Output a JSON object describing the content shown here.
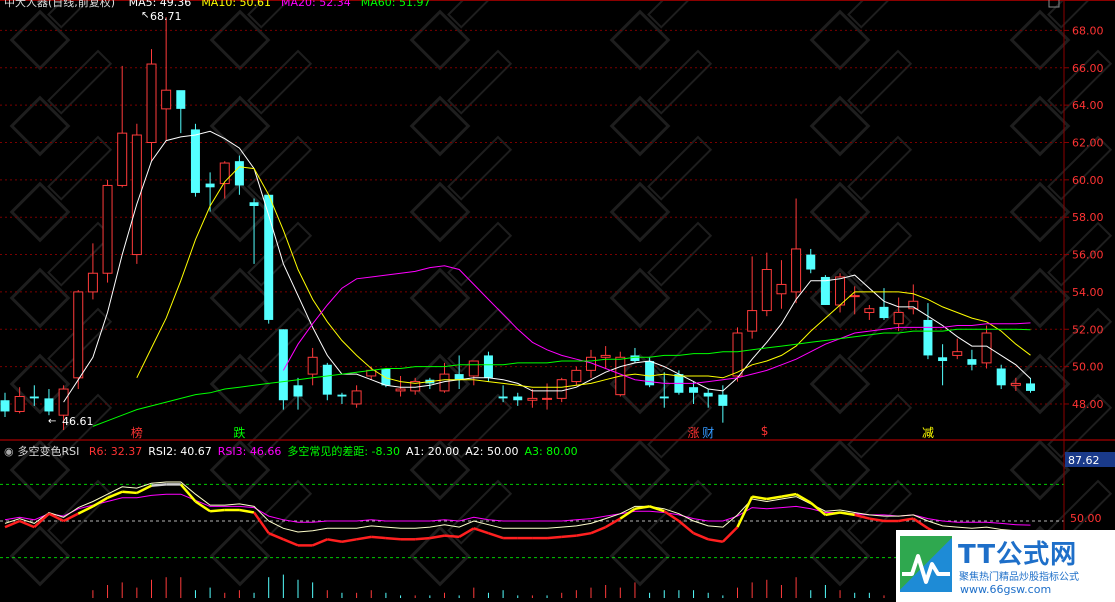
{
  "header": {
    "title": "中大人器(日线,前复权)",
    "ma": [
      {
        "label": "MA5: 49.36",
        "color": "#ffffff"
      },
      {
        "label": "MA10: 50.61",
        "color": "#ffff00"
      },
      {
        "label": "MA20: 52.34",
        "color": "#ff00ff"
      },
      {
        "label": "MA60: 51.97",
        "color": "#00ff00"
      }
    ]
  },
  "sub_header": {
    "title": "多空变色RSI",
    "items": [
      {
        "label": "R6: 32.37",
        "color": "#ff3333"
      },
      {
        "label": "RSI2: 40.67",
        "color": "#ffffff"
      },
      {
        "label": "RSI3: 46.66",
        "color": "#ff00ff"
      },
      {
        "label": "多空常见的差距: -8.30",
        "color": "#00ff00"
      },
      {
        "label": "A1: 20.00",
        "color": "#ffffff"
      },
      {
        "label": "A2: 50.00",
        "color": "#ffffff"
      },
      {
        "label": "A3: 80.00",
        "color": "#00ff00"
      }
    ]
  },
  "markers": [
    {
      "text": "榜",
      "color": "#ff3333",
      "i": 9
    },
    {
      "text": "跌",
      "color": "#00ff00",
      "i": 16
    },
    {
      "text": "涨",
      "color": "#ff3333",
      "i": 47
    },
    {
      "text": "财",
      "color": "#3399ff",
      "i": 48
    },
    {
      "text": "$",
      "color": "#ff3333",
      "i": 52
    },
    {
      "text": "减",
      "color": "#ffff00",
      "i": 63
    }
  ],
  "annotations": {
    "high": "68.71",
    "low": "46.61"
  },
  "sub_axis_labels": {
    "top": "87.62",
    "mid": "50.00"
  },
  "logo": {
    "brand": "TT公式网",
    "slogan": "聚焦热门精品炒股指标公式",
    "url": "www.66gsw.com"
  },
  "chart_data": {
    "type": "candlestick",
    "ylim": [
      46.5,
      69.2
    ],
    "yticks": [
      48,
      50,
      52,
      54,
      56,
      58,
      60,
      62,
      64,
      66,
      68
    ],
    "ytick_labels": [
      "48.00",
      "50.00",
      "52.00",
      "54.00",
      "56.00",
      "58.00",
      "60.00",
      "62.00",
      "64.00",
      "66.00",
      "68.00"
    ],
    "ohlc": [
      [
        48.2,
        48.6,
        47.3,
        47.6
      ],
      [
        47.6,
        48.9,
        47.5,
        48.4
      ],
      [
        48.4,
        49.0,
        47.9,
        48.3
      ],
      [
        48.3,
        48.8,
        47.4,
        47.6
      ],
      [
        47.4,
        49.0,
        46.61,
        48.8
      ],
      [
        49.4,
        54.1,
        48.8,
        54.0
      ],
      [
        54.0,
        56.6,
        53.6,
        55.0
      ],
      [
        55.0,
        60.0,
        54.5,
        59.7
      ],
      [
        59.7,
        66.1,
        59.6,
        62.5
      ],
      [
        56.0,
        63.0,
        55.5,
        62.4
      ],
      [
        62.0,
        67.0,
        61.0,
        66.2
      ],
      [
        63.8,
        68.71,
        62.1,
        64.8
      ],
      [
        64.8,
        64.6,
        62.5,
        63.8
      ],
      [
        62.7,
        63.0,
        59.1,
        59.3
      ],
      [
        59.8,
        60.4,
        58.3,
        59.6
      ],
      [
        59.8,
        61.0,
        59.0,
        60.9
      ],
      [
        61.0,
        61.3,
        59.2,
        59.7
      ],
      [
        58.8,
        59.0,
        55.5,
        58.6
      ],
      [
        59.2,
        59.2,
        52.3,
        52.5
      ],
      [
        52.0,
        52.0,
        47.7,
        48.2
      ],
      [
        49.0,
        49.4,
        47.7,
        48.4
      ],
      [
        49.6,
        51.0,
        49.0,
        50.5
      ],
      [
        50.1,
        50.2,
        48.2,
        48.5
      ],
      [
        48.5,
        48.6,
        48.0,
        48.4
      ],
      [
        48.0,
        49.0,
        47.8,
        48.7
      ],
      [
        49.5,
        50.0,
        49.3,
        49.8
      ],
      [
        49.9,
        49.9,
        48.9,
        49.0
      ],
      [
        48.7,
        49.5,
        48.4,
        48.8
      ],
      [
        48.7,
        49.4,
        48.5,
        49.2
      ],
      [
        49.3,
        49.4,
        48.8,
        49.1
      ],
      [
        48.7,
        50.2,
        48.6,
        49.6
      ],
      [
        49.6,
        50.6,
        48.8,
        49.3
      ],
      [
        49.5,
        50.3,
        49.0,
        50.3
      ],
      [
        50.6,
        50.8,
        49.2,
        49.4
      ],
      [
        48.4,
        49.0,
        48.1,
        48.3
      ],
      [
        48.4,
        48.6,
        47.9,
        48.2
      ],
      [
        48.2,
        48.8,
        47.8,
        48.3
      ],
      [
        48.3,
        49.1,
        47.7,
        48.3
      ],
      [
        48.3,
        49.4,
        48.1,
        49.3
      ],
      [
        49.2,
        50.0,
        49.0,
        49.8
      ],
      [
        49.8,
        50.9,
        49.4,
        50.5
      ],
      [
        50.5,
        51.1,
        49.9,
        50.6
      ],
      [
        48.5,
        50.8,
        48.4,
        50.5
      ],
      [
        50.6,
        51.0,
        50.2,
        50.3
      ],
      [
        50.3,
        50.5,
        48.9,
        49.0
      ],
      [
        48.4,
        49.7,
        47.8,
        48.3
      ],
      [
        49.6,
        49.8,
        48.5,
        48.6
      ],
      [
        48.9,
        49.2,
        48.0,
        48.6
      ],
      [
        48.6,
        48.8,
        47.8,
        48.4
      ],
      [
        48.5,
        49.0,
        47.0,
        47.9
      ],
      [
        49.5,
        52.1,
        49.2,
        51.8
      ],
      [
        51.9,
        55.9,
        51.5,
        53.0
      ],
      [
        53.0,
        56.1,
        52.7,
        55.2
      ],
      [
        53.9,
        55.7,
        53.1,
        54.4
      ],
      [
        54.0,
        59.0,
        53.4,
        56.3
      ],
      [
        56.0,
        56.3,
        55.0,
        55.2
      ],
      [
        54.8,
        54.9,
        53.3,
        53.3
      ],
      [
        53.3,
        55.0,
        52.9,
        54.8
      ],
      [
        53.8,
        54.3,
        52.8,
        53.8
      ],
      [
        52.9,
        53.3,
        52.5,
        53.1
      ],
      [
        53.2,
        54.2,
        52.5,
        52.6
      ],
      [
        52.3,
        53.7,
        51.9,
        52.9
      ],
      [
        53.1,
        54.4,
        52.8,
        53.5
      ],
      [
        52.5,
        53.4,
        50.4,
        50.6
      ],
      [
        50.5,
        51.2,
        49.0,
        50.3
      ],
      [
        50.6,
        51.5,
        50.4,
        50.8
      ],
      [
        50.4,
        50.9,
        49.8,
        50.1
      ],
      [
        50.2,
        52.2,
        49.9,
        51.8
      ],
      [
        49.9,
        50.1,
        48.8,
        49.0
      ],
      [
        49.0,
        49.4,
        48.7,
        49.1
      ],
      [
        49.1,
        49.4,
        48.6,
        48.7
      ]
    ],
    "ma_series": [
      {
        "name": "MA5",
        "color": "#ffffff",
        "values": [
          null,
          null,
          null,
          null,
          48.1,
          49.3,
          50.5,
          52.9,
          56.0,
          58.7,
          61.0,
          62.1,
          62.3,
          62.4,
          62.6,
          62.2,
          61.7,
          60.6,
          58.1,
          55.5,
          53.8,
          52.1,
          50.6,
          49.6,
          49.6,
          49.3,
          49.0,
          48.9,
          48.9,
          49.0,
          49.2,
          49.3,
          49.4,
          49.4,
          49.3,
          49.1,
          48.7,
          48.7,
          48.7,
          48.9,
          49.3,
          49.7,
          50.0,
          50.2,
          50.3,
          50.0,
          49.6,
          49.2,
          48.8,
          48.7,
          49.4,
          50.4,
          51.3,
          52.3,
          53.6,
          54.6,
          54.6,
          54.7,
          54.9,
          54.2,
          53.5,
          53.2,
          53.2,
          52.7,
          52.2,
          51.6,
          51.1,
          51.1,
          50.6,
          50.1,
          49.36
        ]
      },
      {
        "name": "MA10",
        "color": "#ffff00",
        "values": [
          null,
          null,
          null,
          null,
          null,
          null,
          null,
          null,
          null,
          49.4,
          51.0,
          52.6,
          54.6,
          56.8,
          58.6,
          59.9,
          60.7,
          60.6,
          59.2,
          57.3,
          55.2,
          53.6,
          52.4,
          51.4,
          50.6,
          49.9,
          49.4,
          49.2,
          49.1,
          49.2,
          49.3,
          49.3,
          49.3,
          49.2,
          49.1,
          49.0,
          48.9,
          48.9,
          48.9,
          49.0,
          49.1,
          49.3,
          49.5,
          49.6,
          49.5,
          49.6,
          49.5,
          49.5,
          49.5,
          49.4,
          49.7,
          50.1,
          50.3,
          50.6,
          51.1,
          51.9,
          52.6,
          53.3,
          54.0,
          54.0,
          54.0,
          54.0,
          53.9,
          53.6,
          53.2,
          52.9,
          52.6,
          52.4,
          51.9,
          51.2,
          50.61
        ]
      },
      {
        "name": "MA20",
        "color": "#ff00ff",
        "values": [
          null,
          null,
          null,
          null,
          null,
          null,
          null,
          null,
          null,
          null,
          null,
          null,
          null,
          null,
          null,
          null,
          null,
          null,
          null,
          49.8,
          51.2,
          52.3,
          53.3,
          54.2,
          54.7,
          54.8,
          54.9,
          55.0,
          55.1,
          55.3,
          55.4,
          55.2,
          54.4,
          53.6,
          52.8,
          52.0,
          51.3,
          50.9,
          50.6,
          50.4,
          50.2,
          49.9,
          49.6,
          49.3,
          49.2,
          49.1,
          49.1,
          49.1,
          49.2,
          49.3,
          49.4,
          49.6,
          49.8,
          50.1,
          50.4,
          50.8,
          51.2,
          51.5,
          51.8,
          51.9,
          52.0,
          52.1,
          52.1,
          52.1,
          52.1,
          52.2,
          52.2,
          52.3,
          52.3,
          52.3,
          52.34
        ]
      },
      {
        "name": "MA60",
        "color": "#00ff00",
        "values": [
          null,
          null,
          null,
          null,
          null,
          null,
          46.8,
          47.1,
          47.4,
          47.7,
          47.9,
          48.1,
          48.3,
          48.5,
          48.6,
          48.8,
          48.9,
          49.0,
          49.1,
          49.2,
          49.3,
          49.4,
          49.5,
          49.6,
          49.7,
          49.8,
          49.9,
          49.9,
          50.0,
          50.0,
          50.0,
          50.1,
          50.1,
          50.1,
          50.1,
          50.2,
          50.2,
          50.2,
          50.3,
          50.3,
          50.3,
          50.4,
          50.4,
          50.5,
          50.5,
          50.6,
          50.6,
          50.7,
          50.7,
          50.8,
          50.8,
          50.9,
          51.0,
          51.1,
          51.2,
          51.3,
          51.4,
          51.5,
          51.6,
          51.7,
          51.8,
          51.8,
          51.9,
          51.9,
          51.9,
          52.0,
          52.0,
          52.0,
          52.0,
          52.0,
          51.97
        ]
      }
    ],
    "rsi": {
      "ylim": [
        0,
        100
      ],
      "levels": [
        20,
        50,
        80
      ],
      "r6": [
        45,
        50,
        45,
        56,
        50,
        56,
        62,
        69,
        74,
        73,
        79,
        80,
        80,
        66,
        58,
        59,
        59,
        57,
        40,
        35,
        30,
        30,
        35,
        33,
        35,
        37,
        36,
        35,
        35,
        36,
        38,
        37,
        44,
        40,
        36,
        36,
        36,
        36,
        37,
        38,
        40,
        45,
        52,
        60,
        62,
        58,
        50,
        40,
        35,
        33,
        45,
        70,
        68,
        70,
        72,
        65,
        55,
        57,
        55,
        52,
        50,
        50,
        52,
        44,
        38,
        38,
        37,
        38,
        35,
        33,
        32.37
      ],
      "rsi2": [
        48,
        52,
        48,
        57,
        53,
        61,
        66,
        72,
        78,
        77,
        81,
        82,
        82,
        72,
        63,
        63,
        64,
        62,
        50,
        44,
        41,
        42,
        44,
        44,
        44,
        46,
        45,
        44,
        44,
        45,
        47,
        45,
        50,
        47,
        44,
        44,
        44,
        44,
        45,
        46,
        48,
        52,
        56,
        62,
        62,
        60,
        56,
        50,
        46,
        45,
        55,
        68,
        66,
        68,
        70,
        64,
        58,
        59,
        57,
        55,
        54,
        54,
        55,
        50,
        46,
        45,
        44,
        45,
        43,
        42,
        40.67
      ],
      "rsi3": [
        51,
        53,
        51,
        56,
        54,
        60,
        63,
        66,
        69,
        69,
        71,
        72,
        72,
        67,
        62,
        62,
        62,
        61,
        54,
        51,
        49,
        49,
        50,
        50,
        50,
        51,
        50,
        50,
        50,
        50,
        51,
        50,
        53,
        51,
        50,
        50,
        50,
        50,
        50,
        51,
        52,
        54,
        56,
        58,
        58,
        57,
        55,
        52,
        50,
        50,
        54,
        61,
        60,
        61,
        62,
        60,
        57,
        57,
        56,
        55,
        55,
        54,
        55,
        52,
        50,
        49,
        49,
        49,
        48,
        47,
        46.66
      ],
      "bars": [
        0,
        0,
        0,
        0,
        0,
        0,
        3,
        5,
        6,
        4,
        7,
        8,
        8,
        -3,
        -4,
        2,
        3,
        -2,
        -8,
        -9,
        -7,
        -6,
        3,
        -2,
        2,
        3,
        -2,
        -1,
        1,
        -1,
        2,
        -1,
        4,
        -2,
        -3,
        -1,
        1,
        -1,
        2,
        3,
        4,
        5,
        4,
        6,
        -2,
        -3,
        -3,
        -3,
        -2,
        -1,
        4,
        6,
        7,
        5,
        8,
        -3,
        -5,
        3,
        -2,
        -2,
        1,
        -1,
        3,
        -5,
        -4,
        2,
        -2,
        3,
        -3,
        -2,
        -1
      ]
    }
  }
}
